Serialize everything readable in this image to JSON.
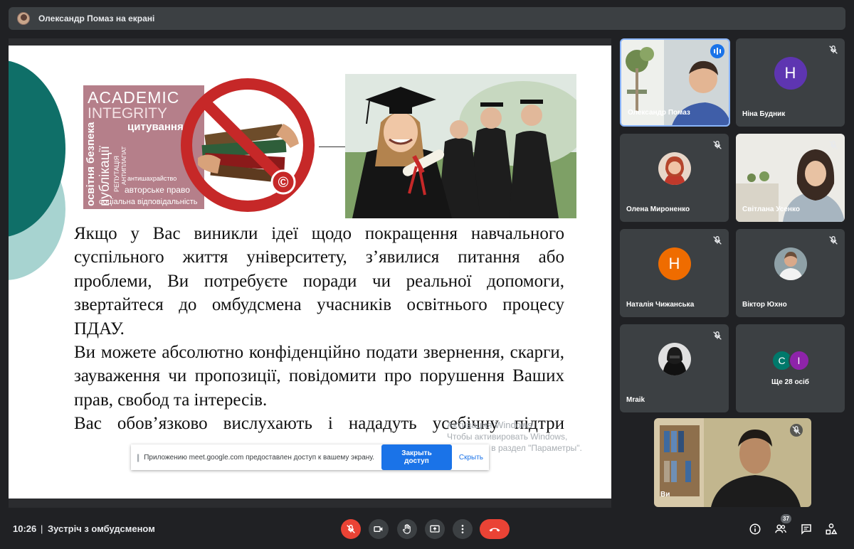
{
  "presenter_bar": {
    "label": "Олександр Помаз на екрані"
  },
  "slide": {
    "image_left_words": {
      "academic": "ACADEMIC",
      "integrity": "INTEGRITY",
      "citation": "цитування",
      "vert_safety": "освітня безпека",
      "vert_publications": "публікації",
      "vert_reputation": "РЕПУТАЦІЯ",
      "vert_antiplagiat": "АНТИПЛАГІАТ",
      "anti_cheating": "антишахрайство",
      "copyright": "авторське право",
      "social_resp": "соціальна відповідальність"
    },
    "paragraphs": [
      "Якщо у Вас виникли ідеї щодо покращення навчального суспільного життя університету, з’явилися питання або проблеми, Ви потребуєте поради чи реальної допомоги, звертайтеся до омбудсмена учасників освітнього процесу ПДАУ.",
      "Ви можете абсолютно конфіденційно подати звернення, скарги, зауваження чи пропозиції, повідомити про порушення Ваших прав, свобод та інтересів.",
      "Вас обов’язково вислухають і нададуть усебічну підтри"
    ]
  },
  "windows_watermark": {
    "title": "Активация Windows",
    "line1": "Чтобы активировать Windows,",
    "line2": "перейдите в раздел \"Параметры\"."
  },
  "share_notice": {
    "message": "Приложению meet.google.com предоставлен доступ к вашему экрану.",
    "stop_label": "Закрыть доступ",
    "hide_label": "Скрыть"
  },
  "participants": [
    {
      "name": "Олександр Помаз",
      "type": "video",
      "speaking": true
    },
    {
      "name": "Ніна Будник",
      "type": "letter",
      "letter": "Н",
      "color": "#5e35b1",
      "muted": true
    },
    {
      "name": "Олена Мироненко",
      "type": "photo",
      "muted": true
    },
    {
      "name": "Світлана Усенко",
      "type": "video",
      "muted": true
    },
    {
      "name": "Наталія Чижанська",
      "type": "letter",
      "letter": "Н",
      "color": "#ef6c00",
      "muted": true
    },
    {
      "name": "Віктор Юхно",
      "type": "photo",
      "muted": true
    },
    {
      "name": "Mraik",
      "type": "photo",
      "muted": true
    },
    {
      "name": "Ще 28 осіб",
      "type": "more",
      "letters": [
        "C",
        "I"
      ],
      "colors": [
        "#00796b",
        "#8e24aa"
      ]
    },
    {
      "name": "Ви",
      "type": "video",
      "muted": true
    }
  ],
  "bottom": {
    "time": "10:26",
    "separator": "|",
    "meeting_title": "Зустріч з омбудсменом",
    "participants_count": "37"
  },
  "colors": {
    "background": "#202124",
    "tile": "#3c4043",
    "red": "#ea4335",
    "accent_blue": "#1a73e8"
  },
  "icons": [
    "mic-off-icon",
    "camera-icon",
    "raise-hand-icon",
    "present-screen-icon",
    "more-options-icon",
    "hang-up-icon",
    "info-icon",
    "people-icon",
    "chat-icon",
    "activities-icon"
  ]
}
